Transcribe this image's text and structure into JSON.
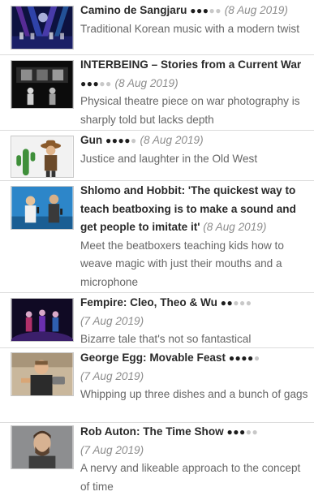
{
  "reviews": [
    {
      "title": "Camino de Sangjaru",
      "rating": 3,
      "max": 5,
      "date": "(8 Aug 2019)",
      "desc": "Traditional Korean music with a modern twist",
      "thumb": "concert-stage"
    },
    {
      "title": "INTERBEING – Stories from a Current War",
      "rating": 3,
      "max": 5,
      "date": "(8 Aug 2019)",
      "desc": "Physical theatre piece on war photography is sharply told but lacks depth",
      "thumb": "theatre-dark"
    },
    {
      "title": "Gun",
      "rating": 4,
      "max": 5,
      "date": "(8 Aug 2019)",
      "desc": "Justice and laughter in the Old West",
      "thumb": "cowboy-cactus"
    },
    {
      "title": "Shlomo and Hobbit: 'The quickest way to teach beatboxing is to make a sound and get people to imitate it'",
      "rating": null,
      "max": 5,
      "date": "(8 Aug 2019)",
      "desc": "Meet the beatboxers teaching kids how to weave magic with just their mouths and a microphone",
      "thumb": "beatboxers"
    },
    {
      "title": "Fempire: Cleo, Theo & Wu",
      "rating": 2,
      "max": 5,
      "date": "(7 Aug 2019)",
      "desc": "Bizarre tale that's not so fantastical",
      "thumb": "three-performers"
    },
    {
      "title": "George Egg: Movable Feast",
      "rating": 4,
      "max": 5,
      "date": "(7 Aug 2019)",
      "desc": "Whipping up three dishes and a bunch of gags",
      "thumb": "chef-portrait"
    },
    {
      "title": "Rob Auton: The Time Show",
      "rating": 3,
      "max": 5,
      "date": "(7 Aug 2019)",
      "desc": "A nervy and likeable approach to the concept of time",
      "thumb": "man-portrait"
    }
  ]
}
